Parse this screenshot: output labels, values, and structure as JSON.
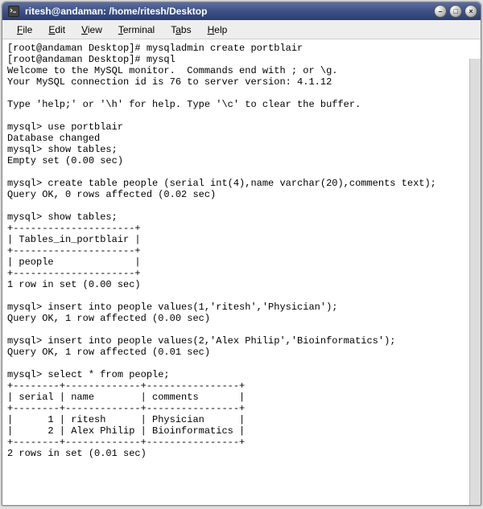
{
  "window": {
    "title": "ritesh@andaman: /home/ritesh/Desktop",
    "icon_name": "terminal-icon"
  },
  "menu": {
    "items": [
      {
        "label": "File",
        "accel": "F"
      },
      {
        "label": "Edit",
        "accel": "E"
      },
      {
        "label": "View",
        "accel": "V"
      },
      {
        "label": "Terminal",
        "accel": "T"
      },
      {
        "label": "Tabs",
        "accel": "a"
      },
      {
        "label": "Help",
        "accel": "H"
      }
    ]
  },
  "terminal": {
    "lines": [
      "[root@andaman Desktop]# mysqladmin create portblair",
      "[root@andaman Desktop]# mysql",
      "Welcome to the MySQL monitor.  Commands end with ; or \\g.",
      "Your MySQL connection id is 76 to server version: 4.1.12",
      "",
      "Type 'help;' or '\\h' for help. Type '\\c' to clear the buffer.",
      "",
      "mysql> use portblair",
      "Database changed",
      "mysql> show tables;",
      "Empty set (0.00 sec)",
      "",
      "mysql> create table people (serial int(4),name varchar(20),comments text);",
      "Query OK, 0 rows affected (0.02 sec)",
      "",
      "mysql> show tables;",
      "+---------------------+",
      "| Tables_in_portblair |",
      "+---------------------+",
      "| people              |",
      "+---------------------+",
      "1 row in set (0.00 sec)",
      "",
      "mysql> insert into people values(1,'ritesh','Physician');",
      "Query OK, 1 row affected (0.00 sec)",
      "",
      "mysql> insert into people values(2,'Alex Philip','Bioinformatics');",
      "Query OK, 1 row affected (0.01 sec)",
      "",
      "mysql> select * from people;",
      "+--------+-------------+----------------+",
      "| serial | name        | comments       |",
      "+--------+-------------+----------------+",
      "|      1 | ritesh      | Physician      |",
      "|      2 | Alex Philip | Bioinformatics |",
      "+--------+-------------+----------------+",
      "2 rows in set (0.01 sec)",
      ""
    ]
  },
  "window_controls": {
    "minimize": "–",
    "maximize": "□",
    "close": "×"
  }
}
